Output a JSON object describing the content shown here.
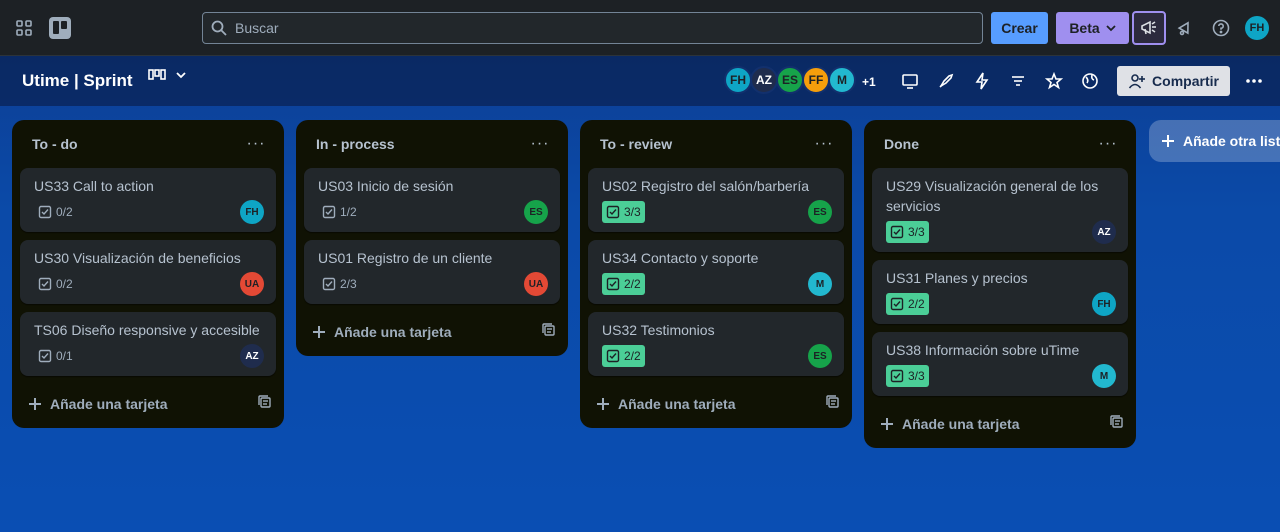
{
  "topbar": {
    "search_placeholder": "Buscar",
    "create_label": "Crear",
    "beta_label": "Beta",
    "user_initials": "FH"
  },
  "board": {
    "title": "Utime | Sprint",
    "members": [
      {
        "initials": "FH",
        "color": "#0ea5c5"
      },
      {
        "initials": "AZ",
        "color": "#1f2c4d"
      },
      {
        "initials": "ES",
        "color": "#16a34a"
      },
      {
        "initials": "FF",
        "color": "#f59e0b"
      },
      {
        "initials": "M",
        "color": "#22b8cf"
      }
    ],
    "members_more": "+1",
    "share_label": "Compartir"
  },
  "lists": [
    {
      "title": "To - do",
      "cards": [
        {
          "title": "US33 Call to action",
          "checklist": "0/2",
          "complete": false,
          "member": "FH",
          "member_color": "#0ea5c5"
        },
        {
          "title": "US30 Visualización de beneficios",
          "checklist": "0/2",
          "complete": false,
          "member": "UA",
          "member_color": "#e34935"
        },
        {
          "title": "TS06 Diseño responsive y accesible",
          "checklist": "0/1",
          "complete": false,
          "member": "AZ",
          "member_color": "#1f2c4d"
        }
      ],
      "add_label": "Añade una tarjeta"
    },
    {
      "title": "In - process",
      "cards": [
        {
          "title": "US03 Inicio de sesión",
          "checklist": "1/2",
          "complete": false,
          "member": "ES",
          "member_color": "#16a34a"
        },
        {
          "title": "US01 Registro de un cliente",
          "checklist": "2/3",
          "complete": false,
          "member": "UA",
          "member_color": "#e34935"
        }
      ],
      "add_label": "Añade una tarjeta"
    },
    {
      "title": "To - review",
      "cards": [
        {
          "title": "US02 Registro del salón/barbería",
          "checklist": "3/3",
          "complete": true,
          "member": "ES",
          "member_color": "#16a34a"
        },
        {
          "title": "US34 Contacto y soporte",
          "checklist": "2/2",
          "complete": true,
          "member": "M",
          "member_color": "#22b8cf"
        },
        {
          "title": "US32 Testimonios",
          "checklist": "2/2",
          "complete": true,
          "member": "ES",
          "member_color": "#16a34a"
        }
      ],
      "add_label": "Añade una tarjeta"
    },
    {
      "title": "Done",
      "cards": [
        {
          "title": "US29 Visualización general de los servicios",
          "checklist": "3/3",
          "complete": true,
          "member": "AZ",
          "member_color": "#1f2c4d"
        },
        {
          "title": "US31 Planes y precios",
          "checklist": "2/2",
          "complete": true,
          "member": "FH",
          "member_color": "#0ea5c5"
        },
        {
          "title": "US38 Información sobre uTime",
          "checklist": "3/3",
          "complete": true,
          "member": "M",
          "member_color": "#22b8cf"
        }
      ],
      "add_label": "Añade una tarjeta"
    }
  ],
  "add_list_label": "Añade otra lista"
}
